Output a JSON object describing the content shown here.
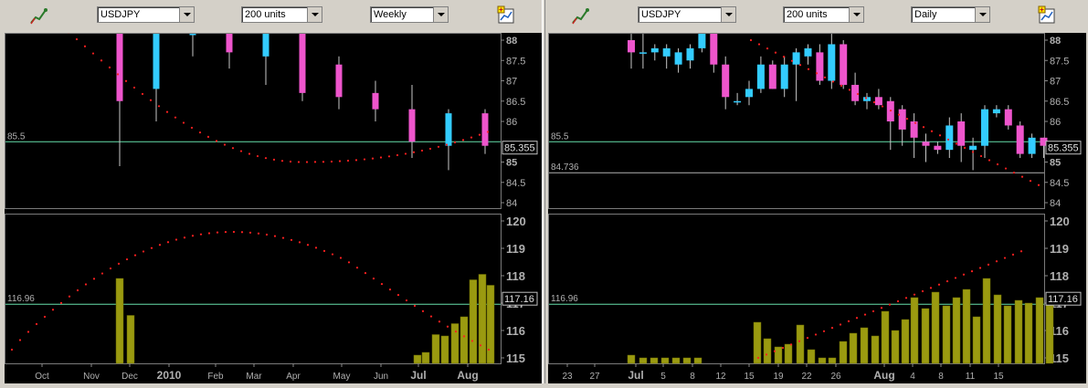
{
  "panels": [
    {
      "symbol": "USDJPY",
      "units": "200 units",
      "period": "Weekly",
      "price": {
        "yticks": [
          "88",
          "87.5",
          "87",
          "86.5",
          "86",
          "85",
          "84.5",
          "84"
        ],
        "hline_label": "85.5",
        "last_label": "85.355"
      },
      "volume": {
        "yticks": [
          "120",
          "119",
          "118",
          "117",
          "116",
          "115"
        ],
        "hline_label": "116.96",
        "last_label": "117.16"
      },
      "xticks": [
        "Oct",
        "Nov",
        "Dec",
        "2010",
        "Feb",
        "Mar",
        "Apr",
        "May",
        "Jun",
        "Jul",
        "Aug"
      ]
    },
    {
      "symbol": "USDJPY",
      "units": "200 units",
      "period": "Daily",
      "price": {
        "yticks": [
          "88",
          "87.5",
          "87",
          "86.5",
          "86",
          "85",
          "84.5",
          "84"
        ],
        "hline_label": "85.5",
        "hline2_label": "84.736",
        "last_label": "85.355"
      },
      "volume": {
        "yticks": [
          "120",
          "119",
          "118",
          "117",
          "116",
          "115"
        ],
        "hline_label": "116.96",
        "last_label": "117.16"
      },
      "xticks": [
        "23",
        "27",
        "Jul",
        "5",
        "8",
        "12",
        "15",
        "19",
        "22",
        "26",
        "Aug",
        "4",
        "8",
        "11",
        "15"
      ]
    }
  ],
  "colors": {
    "bull": "#33ccff",
    "bear": "#ee55cc",
    "volume": "#9a9a10",
    "dots": "#ff2020",
    "hline": "#66ddaa"
  },
  "chart_data": [
    {
      "type": "candlestick",
      "timeframe": "Weekly",
      "symbol": "USDJPY",
      "yrange": [
        84,
        88
      ],
      "ticks": [
        88,
        87.5,
        87,
        86.5,
        86,
        85,
        84.5,
        84
      ],
      "levels": [
        85.5
      ],
      "last": 85.355,
      "x_labels": [
        "Oct",
        "Nov",
        "Dec",
        "2010",
        "Feb",
        "Mar",
        "Apr",
        "May",
        "Jun",
        "Jul",
        "Aug"
      ],
      "candles": [
        {
          "o": 88.3,
          "h": 88.3,
          "l": 84.9,
          "c": 86.5
        },
        {
          "o": 86.8,
          "h": 88.4,
          "l": 86.0,
          "c": 88.2
        },
        {
          "o": 88.4,
          "h": 88.4,
          "l": 87.6,
          "c": 88.4
        },
        {
          "o": 88.4,
          "h": 88.4,
          "l": 87.3,
          "c": 87.7
        },
        {
          "o": 87.6,
          "h": 88.4,
          "l": 86.9,
          "c": 88.2
        },
        {
          "o": 88.2,
          "h": 88.4,
          "l": 86.5,
          "c": 86.7
        },
        {
          "o": 87.4,
          "h": 87.6,
          "l": 86.3,
          "c": 86.6
        },
        {
          "o": 86.7,
          "h": 87.0,
          "l": 86.0,
          "c": 86.3
        },
        {
          "o": 86.3,
          "h": 86.9,
          "l": 85.1,
          "c": 85.5
        },
        {
          "o": 85.4,
          "h": 86.3,
          "l": 84.8,
          "c": 86.2
        },
        {
          "o": 86.2,
          "h": 86.3,
          "l": 85.2,
          "c": 85.4
        }
      ]
    },
    {
      "type": "bar",
      "timeframe": "Weekly",
      "yrange": [
        115,
        120
      ],
      "ticks": [
        120,
        119,
        118,
        117,
        116,
        115
      ],
      "levels": [
        116.96
      ],
      "last": 117.16,
      "values": [
        117.9,
        116.55,
        115.1,
        115.2,
        115.85,
        115.8,
        116.25,
        116.5,
        117.85,
        118.05,
        117.65
      ]
    },
    {
      "type": "candlestick",
      "timeframe": "Daily",
      "symbol": "USDJPY",
      "yrange": [
        84,
        88
      ],
      "ticks": [
        88,
        87.5,
        87,
        86.5,
        86,
        85,
        84.5,
        84
      ],
      "levels": [
        85.5,
        84.736
      ],
      "last": 85.355,
      "x_labels": [
        "23",
        "27",
        "Jul",
        "5",
        "8",
        "12",
        "15",
        "19",
        "22",
        "26",
        "Aug",
        "4",
        "8",
        "11",
        "15"
      ],
      "candles": [
        {
          "o": 88.0,
          "h": 88.3,
          "l": 87.3,
          "c": 87.7
        },
        {
          "o": 87.7,
          "h": 88.3,
          "l": 87.3,
          "c": 87.7
        },
        {
          "o": 87.7,
          "h": 87.9,
          "l": 87.5,
          "c": 87.8
        },
        {
          "o": 87.6,
          "h": 87.9,
          "l": 87.3,
          "c": 87.8
        },
        {
          "o": 87.4,
          "h": 87.8,
          "l": 87.2,
          "c": 87.7
        },
        {
          "o": 87.5,
          "h": 87.9,
          "l": 87.3,
          "c": 87.8
        },
        {
          "o": 87.8,
          "h": 88.3,
          "l": 87.7,
          "c": 88.2
        },
        {
          "o": 88.3,
          "h": 88.4,
          "l": 87.2,
          "c": 87.4
        },
        {
          "o": 87.4,
          "h": 87.6,
          "l": 86.3,
          "c": 86.6
        },
        {
          "o": 86.5,
          "h": 86.7,
          "l": 86.4,
          "c": 86.5
        },
        {
          "o": 86.6,
          "h": 87.0,
          "l": 86.4,
          "c": 86.8
        },
        {
          "o": 86.8,
          "h": 87.6,
          "l": 86.7,
          "c": 87.4
        },
        {
          "o": 87.4,
          "h": 87.5,
          "l": 86.8,
          "c": 86.8
        },
        {
          "o": 86.8,
          "h": 87.6,
          "l": 86.6,
          "c": 87.4
        },
        {
          "o": 87.4,
          "h": 87.8,
          "l": 86.5,
          "c": 87.7
        },
        {
          "o": 87.6,
          "h": 87.9,
          "l": 87.4,
          "c": 87.8
        },
        {
          "o": 87.7,
          "h": 87.9,
          "l": 86.9,
          "c": 87.0
        },
        {
          "o": 87.0,
          "h": 88.3,
          "l": 86.8,
          "c": 87.9
        },
        {
          "o": 87.9,
          "h": 88.0,
          "l": 86.8,
          "c": 86.9
        },
        {
          "o": 86.9,
          "h": 87.2,
          "l": 86.4,
          "c": 86.5
        },
        {
          "o": 86.5,
          "h": 86.7,
          "l": 86.3,
          "c": 86.6
        },
        {
          "o": 86.6,
          "h": 86.8,
          "l": 86.3,
          "c": 86.4
        },
        {
          "o": 86.5,
          "h": 86.6,
          "l": 85.3,
          "c": 86.0
        },
        {
          "o": 86.3,
          "h": 86.4,
          "l": 85.4,
          "c": 85.8
        },
        {
          "o": 86.0,
          "h": 86.2,
          "l": 85.1,
          "c": 85.6
        },
        {
          "o": 85.5,
          "h": 85.7,
          "l": 85.0,
          "c": 85.4
        },
        {
          "o": 85.4,
          "h": 85.5,
          "l": 85.2,
          "c": 85.3
        },
        {
          "o": 85.3,
          "h": 86.1,
          "l": 85.1,
          "c": 85.9
        },
        {
          "o": 86.0,
          "h": 86.2,
          "l": 85.0,
          "c": 85.4
        },
        {
          "o": 85.3,
          "h": 85.6,
          "l": 84.8,
          "c": 85.4
        },
        {
          "o": 85.4,
          "h": 86.4,
          "l": 85.1,
          "c": 86.3
        },
        {
          "o": 86.2,
          "h": 86.4,
          "l": 86.1,
          "c": 86.3
        },
        {
          "o": 86.3,
          "h": 86.4,
          "l": 85.8,
          "c": 85.9
        },
        {
          "o": 85.9,
          "h": 86.0,
          "l": 85.1,
          "c": 85.2
        },
        {
          "o": 85.2,
          "h": 85.7,
          "l": 85.1,
          "c": 85.6
        },
        {
          "o": 85.6,
          "h": 85.6,
          "l": 85.1,
          "c": 85.4
        }
      ]
    },
    {
      "type": "bar",
      "timeframe": "Daily",
      "yrange": [
        115,
        120
      ],
      "ticks": [
        120,
        119,
        118,
        117,
        116,
        115
      ],
      "levels": [
        116.96
      ],
      "last": 117.16,
      "values": [
        115.1,
        115.0,
        115.0,
        115.0,
        115.0,
        115.0,
        115.0,
        116.3,
        115.7,
        115.4,
        115.5,
        116.2,
        115.3,
        115.0,
        115.0,
        115.6,
        115.9,
        116.1,
        115.8,
        116.7,
        116.0,
        116.4,
        117.2,
        116.8,
        117.4,
        116.9,
        117.2,
        117.5,
        116.5,
        117.9,
        117.3,
        116.9,
        117.1,
        117.0,
        117.2,
        117.1
      ]
    }
  ]
}
